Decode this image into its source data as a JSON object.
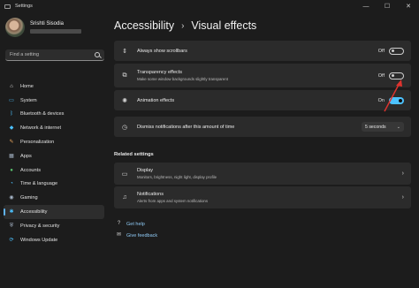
{
  "window": {
    "title": "Settings",
    "minimize_glyph": "—",
    "maximize_glyph": "☐",
    "close_glyph": "✕"
  },
  "profile": {
    "name": "Srishti Sisodia"
  },
  "search": {
    "placeholder": "Find a setting"
  },
  "sidebar": {
    "items": [
      {
        "label": "Home",
        "icon": "home-icon",
        "glyph": "⌂",
        "color": "#e0e0e0"
      },
      {
        "label": "System",
        "icon": "monitor-icon",
        "glyph": "▭",
        "color": "#4cc2ff"
      },
      {
        "label": "Bluetooth & devices",
        "icon": "bluetooth-icon",
        "glyph": "ᛒ",
        "color": "#4cc2ff"
      },
      {
        "label": "Network & internet",
        "icon": "wifi-icon",
        "glyph": "◆",
        "color": "#4cc2ff"
      },
      {
        "label": "Personalization",
        "icon": "brush-icon",
        "glyph": "✎",
        "color": "#e8a45c"
      },
      {
        "label": "Apps",
        "icon": "apps-icon",
        "glyph": "▦",
        "color": "#a7b6c8"
      },
      {
        "label": "Accounts",
        "icon": "accounts-icon",
        "glyph": "●",
        "color": "#5ac46f"
      },
      {
        "label": "Time & language",
        "icon": "clock-icon",
        "glyph": "◔",
        "color": "#4cc2ff"
      },
      {
        "label": "Gaming",
        "icon": "gamepad-icon",
        "glyph": "◉",
        "color": "#a7b6c8"
      },
      {
        "label": "Accessibility",
        "icon": "accessibility-icon",
        "glyph": "✱",
        "color": "#4cc2ff",
        "active": true
      },
      {
        "label": "Privacy & security",
        "icon": "shield-icon",
        "glyph": "⛨",
        "color": "#a7b6c8"
      },
      {
        "label": "Windows Update",
        "icon": "update-icon",
        "glyph": "⟳",
        "color": "#4cc2ff"
      }
    ]
  },
  "breadcrumb": {
    "parent": "Accessibility",
    "separator": "›",
    "current": "Visual effects"
  },
  "settings": {
    "scrollbars": {
      "title": "Always show scrollbars",
      "state": "Off",
      "on": false,
      "icon": "scrollbar-icon",
      "glyph": "⇕"
    },
    "transparency": {
      "title": "Transparency effects",
      "desc": "Make some window backgrounds slightly transparent",
      "state": "Off",
      "on": false,
      "icon": "transparency-icon",
      "glyph": "⧉"
    },
    "animation": {
      "title": "Animation effects",
      "state": "On",
      "on": true,
      "icon": "animation-icon",
      "glyph": "✺"
    },
    "dismiss": {
      "title": "Dismiss notifications after this amount of time",
      "value": "5 seconds",
      "icon": "timer-icon",
      "glyph": "◷"
    }
  },
  "related": {
    "title": "Related settings",
    "display": {
      "title": "Display",
      "desc": "Monitors, brightness, night light, display profile",
      "icon": "display-icon",
      "glyph": "▭"
    },
    "notifications": {
      "title": "Notifications",
      "desc": "Alerts from apps and system notifications",
      "icon": "bell-icon",
      "glyph": "♫"
    }
  },
  "links": {
    "help": {
      "label": "Get help",
      "icon": "help-icon",
      "glyph": "?"
    },
    "feedback": {
      "label": "Give feedback",
      "icon": "feedback-icon",
      "glyph": "✉"
    }
  },
  "colors": {
    "accent": "#4cc2ff",
    "annotation": "#e0332e"
  }
}
